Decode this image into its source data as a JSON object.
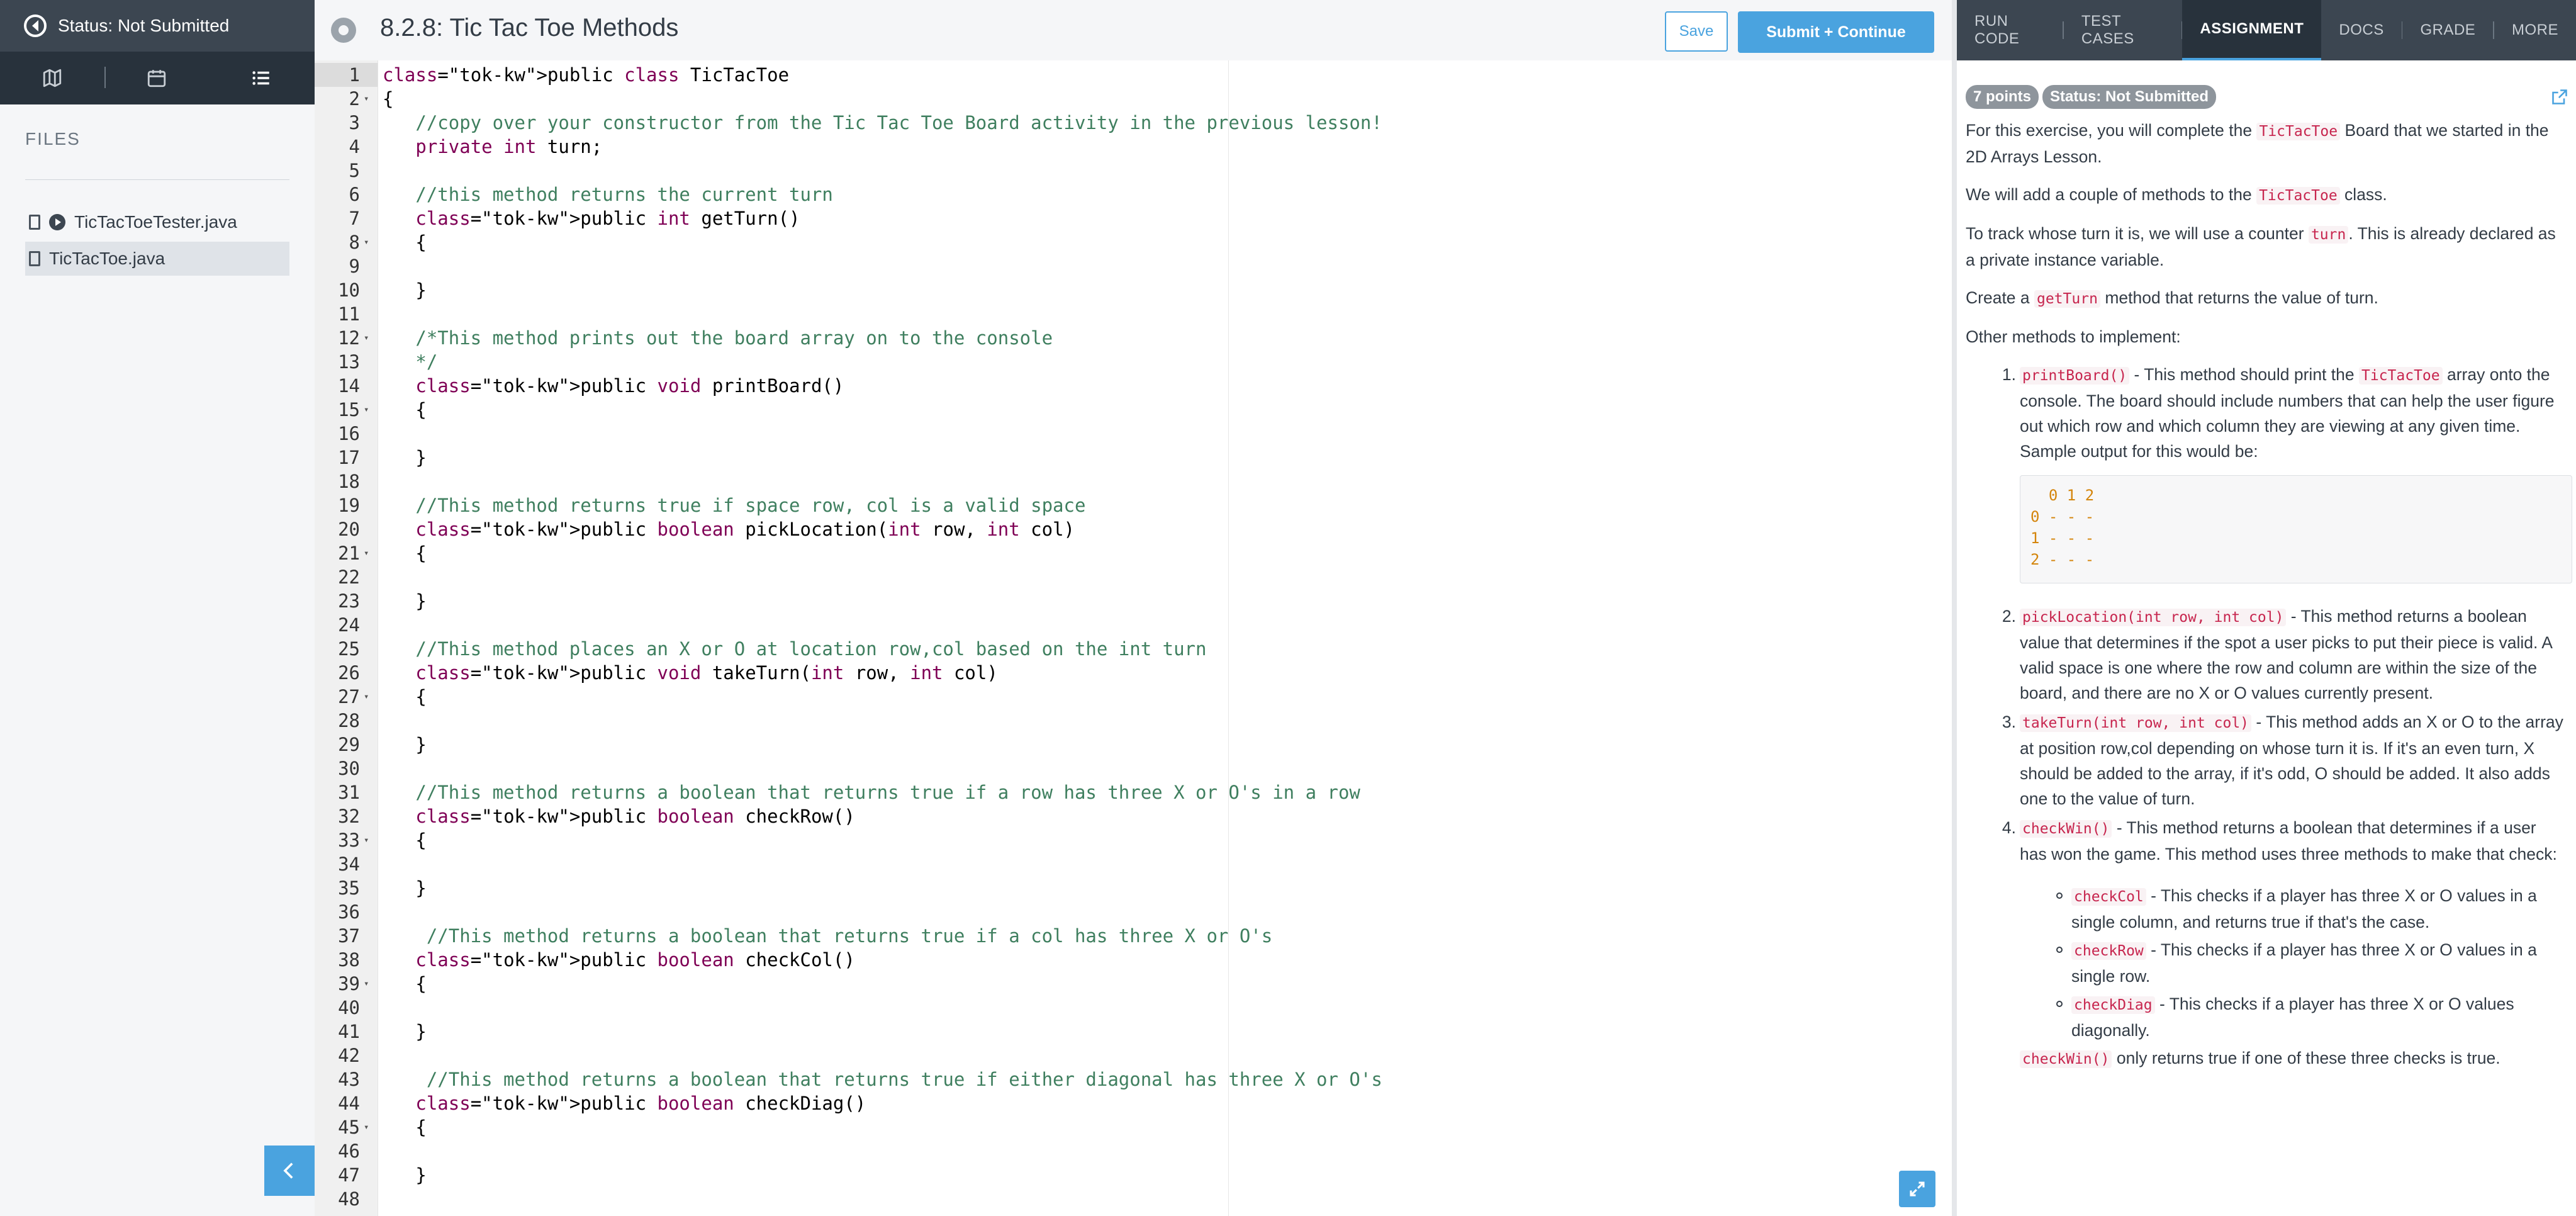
{
  "sidebar": {
    "status_text": "Status: Not Submitted",
    "files_label": "FILES",
    "view_tabs": [
      {
        "icon": "map-icon"
      },
      {
        "icon": "calendar-icon"
      },
      {
        "icon": "list-icon"
      }
    ],
    "files": [
      {
        "name": "TicTacToeTester.java",
        "icon": "play-icon",
        "selected": false
      },
      {
        "name": "TicTacToe.java",
        "icon": "doc-icon",
        "selected": true
      }
    ]
  },
  "editor": {
    "title": "8.2.8: Tic Tac Toe Methods",
    "save_label": "Save",
    "submit_label": "Submit + Continue",
    "code_lines": [
      "public class TicTacToe",
      "{",
      "   //copy over your constructor from the Tic Tac Toe Board activity in the previous lesson!",
      "   private int turn;",
      "",
      "   //this method returns the current turn",
      "   public int getTurn()",
      "   {",
      "",
      "   }",
      "",
      "   /*This method prints out the board array on to the console",
      "   */",
      "   public void printBoard()",
      "   {",
      "",
      "   }",
      "",
      "   //This method returns true if space row, col is a valid space",
      "   public boolean pickLocation(int row, int col)",
      "   {",
      "",
      "   }",
      "",
      "   //This method places an X or O at location row,col based on the int turn",
      "   public void takeTurn(int row, int col)",
      "   {",
      "",
      "   }",
      "",
      "   //This method returns a boolean that returns true if a row has three X or O's in a row",
      "   public boolean checkRow()",
      "   {",
      "",
      "   }",
      "",
      "    //This method returns a boolean that returns true if a col has three X or O's",
      "   public boolean checkCol()",
      "   {",
      "",
      "   }",
      "",
      "    //This method returns a boolean that returns true if either diagonal has three X or O's",
      "   public boolean checkDiag()",
      "   {",
      "",
      "   }",
      ""
    ],
    "fold_lines": [
      2,
      8,
      12,
      15,
      21,
      27,
      33,
      39,
      45
    ]
  },
  "right_panel": {
    "tabs": [
      "RUN CODE",
      "TEST CASES",
      "ASSIGNMENT",
      "DOCS",
      "GRADE",
      "MORE"
    ],
    "active_tab": "ASSIGNMENT",
    "points_badge": "7 points",
    "status_badge": "Status: Not Submitted",
    "p1": [
      {
        "t": "For this exercise, you will complete the "
      },
      {
        "c": "TicTacToe"
      },
      {
        "t": " Board that we started in the 2D Arrays Lesson."
      }
    ],
    "p2": [
      {
        "t": "We will add a couple of methods to the "
      },
      {
        "c": "TicTacToe"
      },
      {
        "t": " class."
      }
    ],
    "p3": [
      {
        "t": "To track whose turn it is, we will use a counter "
      },
      {
        "c": "turn"
      },
      {
        "t": ". This is already declared as a private instance variable."
      }
    ],
    "p4": [
      {
        "t": "Create a "
      },
      {
        "c": "getTurn"
      },
      {
        "t": " method that returns the value of turn."
      }
    ],
    "p5": [
      {
        "t": "Other methods to implement:"
      }
    ],
    "items": [
      [
        {
          "c": "printBoard()"
        },
        {
          "t": " - This method should print the "
        },
        {
          "c": "TicTacToe"
        },
        {
          "t": " array onto the console. The board should include numbers that can help the user figure out which row and which column they are viewing at any given time. Sample output for this would be:"
        }
      ],
      [
        {
          "c": "pickLocation(int row, int col)"
        },
        {
          "t": " - This method returns a boolean value that determines if the spot a user picks to put their piece is valid. A valid space is one where the row and column are within the size of the board, and there are no X or O values currently present."
        }
      ],
      [
        {
          "c": "takeTurn(int row, int col)"
        },
        {
          "t": " - This method adds an X or O to the array at position row,col depending on whose turn it is. If it's an even turn, X should be added to the array, if it's odd, O should be added. It also adds one to the value of turn."
        }
      ],
      [
        {
          "c": "checkWin()"
        },
        {
          "t": " - This method returns a boolean that determines if a user has won the game. This method uses three methods to make that check:"
        }
      ]
    ],
    "sample_output": [
      "  0 1 2",
      "0 - - -",
      "1 - - -",
      "2 - - -"
    ],
    "sub_items": [
      [
        {
          "c": "checkCol"
        },
        {
          "t": " - This checks if a player has three X or O values in a single column, and returns true if that's the case."
        }
      ],
      [
        {
          "c": "checkRow"
        },
        {
          "t": " - This checks if a player has three X or O values in a single row."
        }
      ],
      [
        {
          "c": "checkDiag"
        },
        {
          "t": " - This checks if a player has three X or O values diagonally."
        }
      ]
    ],
    "final_line": [
      {
        "c": "checkWin()"
      },
      {
        "t": " only returns true if one of these three checks is true."
      }
    ]
  }
}
